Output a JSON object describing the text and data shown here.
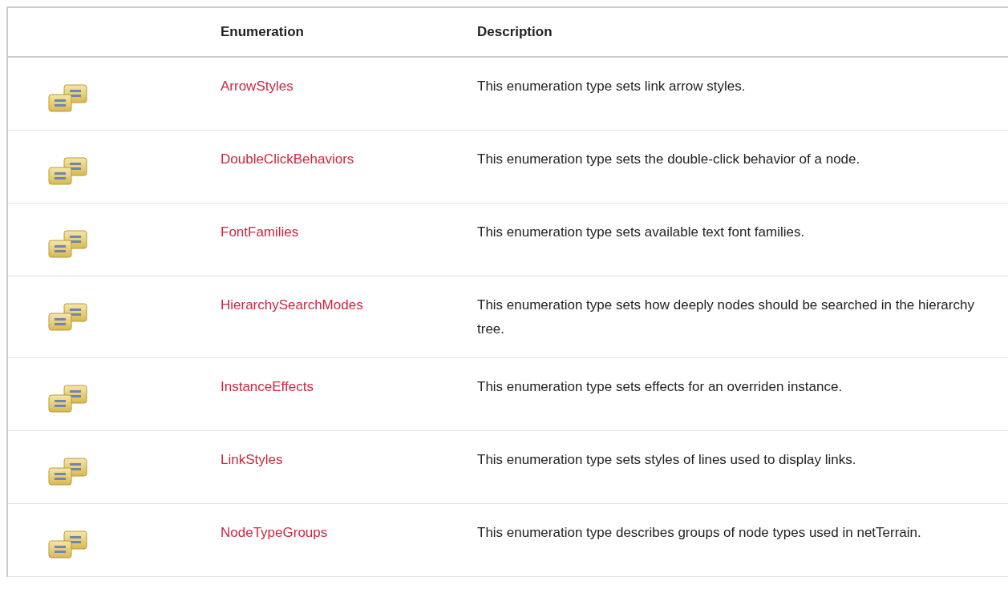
{
  "table": {
    "columns": [
      "Enumeration",
      "Description"
    ],
    "rows": [
      {
        "name": "ArrowStyles",
        "description": "This enumeration type sets link arrow styles."
      },
      {
        "name": "DoubleClickBehaviors",
        "description": "This enumeration type sets the double-click behavior of a node."
      },
      {
        "name": "FontFamilies",
        "description": "This enumeration type sets available text font families."
      },
      {
        "name": "HierarchySearchModes",
        "description": "This enumeration type sets how deeply nodes should be searched in the hierarchy tree."
      },
      {
        "name": "InstanceEffects",
        "description": "This enumeration type sets effects for an overriden instance."
      },
      {
        "name": "LinkStyles",
        "description": "This enumeration type sets styles of lines used to display links."
      },
      {
        "name": "NodeTypeGroups",
        "description": "This enumeration type describes groups of node types used in netTerrain."
      }
    ]
  }
}
